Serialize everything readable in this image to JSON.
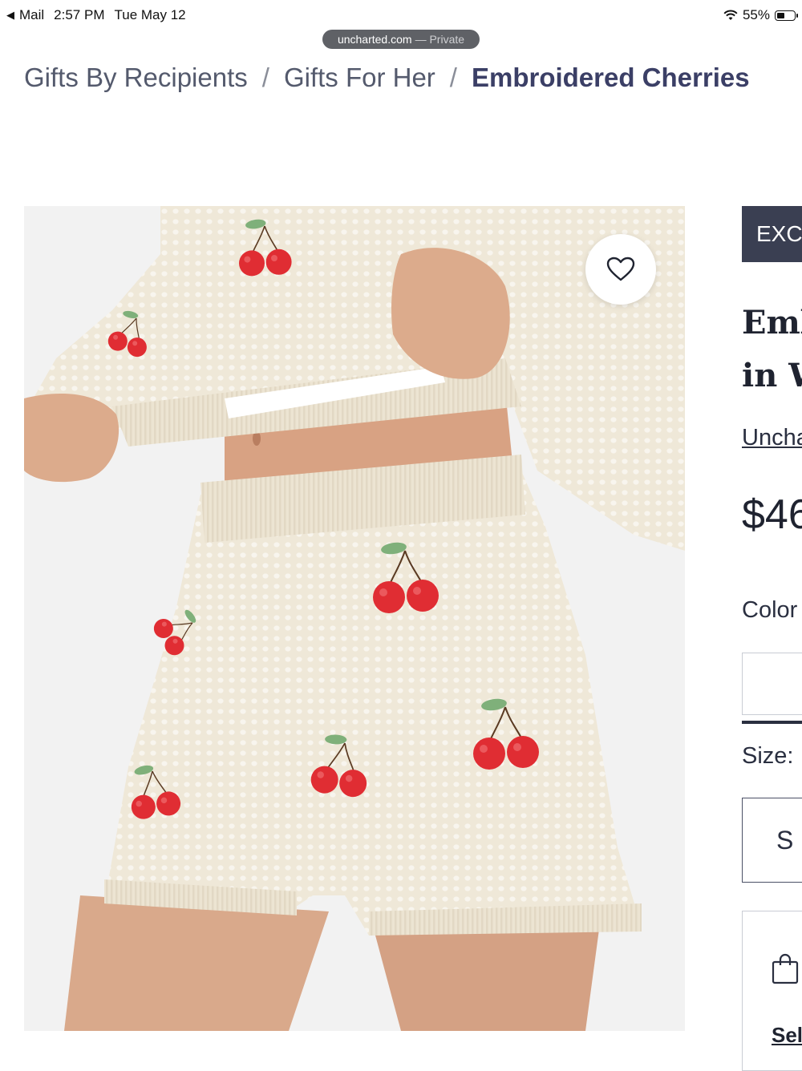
{
  "status_bar": {
    "back_app": "Mail",
    "time": "2:57 PM",
    "date": "Tue May 12",
    "battery": "55%",
    "battery_level": 0.55
  },
  "browser": {
    "url": "uncharted.com",
    "mode": "— Private"
  },
  "breadcrumb": {
    "items": [
      "Gifts By Recipients",
      "Gifts For Her",
      "Embroidered Cherries"
    ],
    "separator": "/"
  },
  "product": {
    "badge": "EXC",
    "title_line1": "Emb",
    "title_line2": "in W",
    "brand": "Uncha",
    "price": "$46",
    "color_label": "Color",
    "size_label": "Size:",
    "size_selected": "S",
    "cart_link": "Sel"
  },
  "colors": {
    "badge_bg": "#3a3f52",
    "breadcrumb_current": "#3b3f66",
    "knit": "#efe8d8",
    "cherry": "#e02d33"
  },
  "icons": {
    "favorite": "heart-icon",
    "bag": "shopping-bag-icon",
    "wifi": "wifi-icon",
    "battery": "battery-icon"
  }
}
